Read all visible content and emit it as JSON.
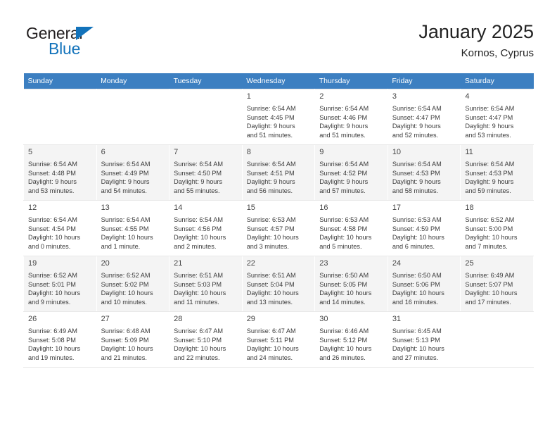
{
  "brand": {
    "name_part1": "General",
    "name_part2": "Blue",
    "triangle_icon": "blue-triangle-icon",
    "accent_color": "#1373bb"
  },
  "header": {
    "title": "January 2025",
    "subtitle": "Kornos, Cyprus",
    "header_bg_color": "#3c7fc1"
  },
  "calendar": {
    "weekday_headers": [
      "Sunday",
      "Monday",
      "Tuesday",
      "Wednesday",
      "Thursday",
      "Friday",
      "Saturday"
    ],
    "weeks": [
      [
        {
          "day": "",
          "sunrise": "",
          "sunset": "",
          "daylight_line1": "",
          "daylight_line2": ""
        },
        {
          "day": "",
          "sunrise": "",
          "sunset": "",
          "daylight_line1": "",
          "daylight_line2": ""
        },
        {
          "day": "",
          "sunrise": "",
          "sunset": "",
          "daylight_line1": "",
          "daylight_line2": ""
        },
        {
          "day": "1",
          "sunrise": "Sunrise: 6:54 AM",
          "sunset": "Sunset: 4:45 PM",
          "daylight_line1": "Daylight: 9 hours",
          "daylight_line2": "and 51 minutes."
        },
        {
          "day": "2",
          "sunrise": "Sunrise: 6:54 AM",
          "sunset": "Sunset: 4:46 PM",
          "daylight_line1": "Daylight: 9 hours",
          "daylight_line2": "and 51 minutes."
        },
        {
          "day": "3",
          "sunrise": "Sunrise: 6:54 AM",
          "sunset": "Sunset: 4:47 PM",
          "daylight_line1": "Daylight: 9 hours",
          "daylight_line2": "and 52 minutes."
        },
        {
          "day": "4",
          "sunrise": "Sunrise: 6:54 AM",
          "sunset": "Sunset: 4:47 PM",
          "daylight_line1": "Daylight: 9 hours",
          "daylight_line2": "and 53 minutes."
        }
      ],
      [
        {
          "day": "5",
          "sunrise": "Sunrise: 6:54 AM",
          "sunset": "Sunset: 4:48 PM",
          "daylight_line1": "Daylight: 9 hours",
          "daylight_line2": "and 53 minutes."
        },
        {
          "day": "6",
          "sunrise": "Sunrise: 6:54 AM",
          "sunset": "Sunset: 4:49 PM",
          "daylight_line1": "Daylight: 9 hours",
          "daylight_line2": "and 54 minutes."
        },
        {
          "day": "7",
          "sunrise": "Sunrise: 6:54 AM",
          "sunset": "Sunset: 4:50 PM",
          "daylight_line1": "Daylight: 9 hours",
          "daylight_line2": "and 55 minutes."
        },
        {
          "day": "8",
          "sunrise": "Sunrise: 6:54 AM",
          "sunset": "Sunset: 4:51 PM",
          "daylight_line1": "Daylight: 9 hours",
          "daylight_line2": "and 56 minutes."
        },
        {
          "day": "9",
          "sunrise": "Sunrise: 6:54 AM",
          "sunset": "Sunset: 4:52 PM",
          "daylight_line1": "Daylight: 9 hours",
          "daylight_line2": "and 57 minutes."
        },
        {
          "day": "10",
          "sunrise": "Sunrise: 6:54 AM",
          "sunset": "Sunset: 4:53 PM",
          "daylight_line1": "Daylight: 9 hours",
          "daylight_line2": "and 58 minutes."
        },
        {
          "day": "11",
          "sunrise": "Sunrise: 6:54 AM",
          "sunset": "Sunset: 4:53 PM",
          "daylight_line1": "Daylight: 9 hours",
          "daylight_line2": "and 59 minutes."
        }
      ],
      [
        {
          "day": "12",
          "sunrise": "Sunrise: 6:54 AM",
          "sunset": "Sunset: 4:54 PM",
          "daylight_line1": "Daylight: 10 hours",
          "daylight_line2": "and 0 minutes."
        },
        {
          "day": "13",
          "sunrise": "Sunrise: 6:54 AM",
          "sunset": "Sunset: 4:55 PM",
          "daylight_line1": "Daylight: 10 hours",
          "daylight_line2": "and 1 minute."
        },
        {
          "day": "14",
          "sunrise": "Sunrise: 6:54 AM",
          "sunset": "Sunset: 4:56 PM",
          "daylight_line1": "Daylight: 10 hours",
          "daylight_line2": "and 2 minutes."
        },
        {
          "day": "15",
          "sunrise": "Sunrise: 6:53 AM",
          "sunset": "Sunset: 4:57 PM",
          "daylight_line1": "Daylight: 10 hours",
          "daylight_line2": "and 3 minutes."
        },
        {
          "day": "16",
          "sunrise": "Sunrise: 6:53 AM",
          "sunset": "Sunset: 4:58 PM",
          "daylight_line1": "Daylight: 10 hours",
          "daylight_line2": "and 5 minutes."
        },
        {
          "day": "17",
          "sunrise": "Sunrise: 6:53 AM",
          "sunset": "Sunset: 4:59 PM",
          "daylight_line1": "Daylight: 10 hours",
          "daylight_line2": "and 6 minutes."
        },
        {
          "day": "18",
          "sunrise": "Sunrise: 6:52 AM",
          "sunset": "Sunset: 5:00 PM",
          "daylight_line1": "Daylight: 10 hours",
          "daylight_line2": "and 7 minutes."
        }
      ],
      [
        {
          "day": "19",
          "sunrise": "Sunrise: 6:52 AM",
          "sunset": "Sunset: 5:01 PM",
          "daylight_line1": "Daylight: 10 hours",
          "daylight_line2": "and 9 minutes."
        },
        {
          "day": "20",
          "sunrise": "Sunrise: 6:52 AM",
          "sunset": "Sunset: 5:02 PM",
          "daylight_line1": "Daylight: 10 hours",
          "daylight_line2": "and 10 minutes."
        },
        {
          "day": "21",
          "sunrise": "Sunrise: 6:51 AM",
          "sunset": "Sunset: 5:03 PM",
          "daylight_line1": "Daylight: 10 hours",
          "daylight_line2": "and 11 minutes."
        },
        {
          "day": "22",
          "sunrise": "Sunrise: 6:51 AM",
          "sunset": "Sunset: 5:04 PM",
          "daylight_line1": "Daylight: 10 hours",
          "daylight_line2": "and 13 minutes."
        },
        {
          "day": "23",
          "sunrise": "Sunrise: 6:50 AM",
          "sunset": "Sunset: 5:05 PM",
          "daylight_line1": "Daylight: 10 hours",
          "daylight_line2": "and 14 minutes."
        },
        {
          "day": "24",
          "sunrise": "Sunrise: 6:50 AM",
          "sunset": "Sunset: 5:06 PM",
          "daylight_line1": "Daylight: 10 hours",
          "daylight_line2": "and 16 minutes."
        },
        {
          "day": "25",
          "sunrise": "Sunrise: 6:49 AM",
          "sunset": "Sunset: 5:07 PM",
          "daylight_line1": "Daylight: 10 hours",
          "daylight_line2": "and 17 minutes."
        }
      ],
      [
        {
          "day": "26",
          "sunrise": "Sunrise: 6:49 AM",
          "sunset": "Sunset: 5:08 PM",
          "daylight_line1": "Daylight: 10 hours",
          "daylight_line2": "and 19 minutes."
        },
        {
          "day": "27",
          "sunrise": "Sunrise: 6:48 AM",
          "sunset": "Sunset: 5:09 PM",
          "daylight_line1": "Daylight: 10 hours",
          "daylight_line2": "and 21 minutes."
        },
        {
          "day": "28",
          "sunrise": "Sunrise: 6:47 AM",
          "sunset": "Sunset: 5:10 PM",
          "daylight_line1": "Daylight: 10 hours",
          "daylight_line2": "and 22 minutes."
        },
        {
          "day": "29",
          "sunrise": "Sunrise: 6:47 AM",
          "sunset": "Sunset: 5:11 PM",
          "daylight_line1": "Daylight: 10 hours",
          "daylight_line2": "and 24 minutes."
        },
        {
          "day": "30",
          "sunrise": "Sunrise: 6:46 AM",
          "sunset": "Sunset: 5:12 PM",
          "daylight_line1": "Daylight: 10 hours",
          "daylight_line2": "and 26 minutes."
        },
        {
          "day": "31",
          "sunrise": "Sunrise: 6:45 AM",
          "sunset": "Sunset: 5:13 PM",
          "daylight_line1": "Daylight: 10 hours",
          "daylight_line2": "and 27 minutes."
        },
        {
          "day": "",
          "sunrise": "",
          "sunset": "",
          "daylight_line1": "",
          "daylight_line2": ""
        }
      ]
    ]
  }
}
